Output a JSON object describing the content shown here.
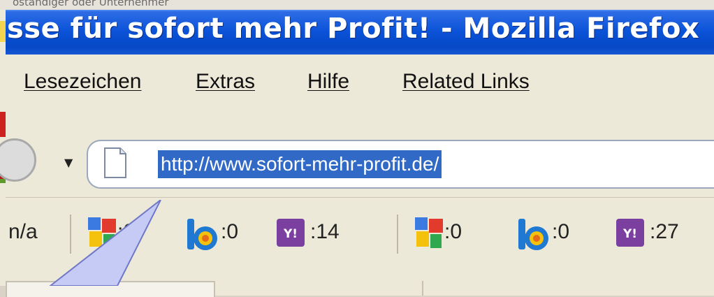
{
  "background_caption": "ostandiger oder Unternehmer",
  "window": {
    "title": "sse für sofort mehr Profit! - Mozilla Firefox"
  },
  "menu": {
    "items": [
      {
        "label": "Lesezeichen"
      },
      {
        "label": "Extras"
      },
      {
        "label": "Hilfe"
      },
      {
        "label": "Related Links"
      }
    ]
  },
  "navigation": {
    "url": "http://www.sofort-mehr-profit.de/",
    "back_icon": "back-arrow-icon",
    "dropdown_glyph": "▼"
  },
  "toolbar": {
    "pagerank": "n/a",
    "stats": [
      {
        "engine": "google-icon",
        "value": ":0"
      },
      {
        "engine": "bing-icon",
        "value": ":0"
      },
      {
        "engine": "yahoo-icon",
        "value": ":14"
      },
      {
        "engine": "google-icon",
        "value": ":0"
      },
      {
        "engine": "bing-icon",
        "value": ":0"
      },
      {
        "engine": "yahoo-icon",
        "value": ":27"
      }
    ]
  },
  "colors": {
    "titlebar": "#0a52d8",
    "url_selection": "#3169c6",
    "yahoo": "#7b3fa0",
    "bing": "#1f78d1"
  }
}
